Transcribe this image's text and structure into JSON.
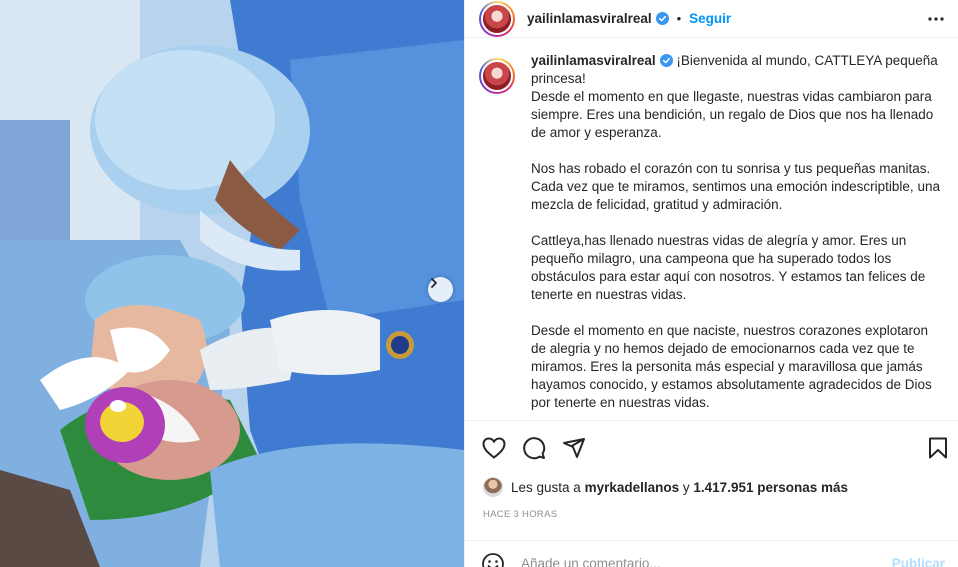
{
  "post": {
    "username": "yailinlamasviralreal",
    "follow_label": "Seguir",
    "separator": "•",
    "caption_paragraphs": [
      "¡Bienvenida al mundo, CATTLEYA pequeña princesa!\nDesde el momento en que llegaste, nuestras vidas cambiaron para siempre. Eres una bendición, un regalo de Dios que nos ha llenado de amor y esperanza.",
      "Nos has robado el corazón con tu sonrisa y tus pequeñas manitas. Cada vez que te miramos, sentimos una emoción indescriptible, una mezcla de felicidad, gratitud y admiración.",
      "Cattleya,has llenado nuestras vidas de alegría y amor. Eres un pequeño milagro, una campeona que ha superado todos los obstáculos para estar aquí con nosotros. Y estamos tan felices de tenerte en nuestras vidas.",
      "Desde el momento en que naciste, nuestros corazones explotaron de alegria y no hemos dejado de emocionarnos cada vez que te miramos. Eres la personita más especial y maravillosa que jamás hayamos conocido, y estamos absolutamente agradecidos de Dios por tenerte en nuestras vidas."
    ],
    "likes": {
      "prefix": "Les gusta a",
      "user": "myrkadellanos",
      "connector": "y",
      "count": "1.417.951 personas más"
    },
    "timestamp": "HACE 3 HORAS",
    "comment": {
      "placeholder": "Añade un comentario...",
      "publish_label": "Publicar"
    }
  },
  "colors": {
    "accent": "#0095f6",
    "publish_disabled": "#b2dffc",
    "text": "#262626",
    "muted": "#8e8e8e",
    "verified": "#3897f0"
  },
  "icons": [
    "verified-badge-icon",
    "more-options-icon",
    "heart-icon",
    "comment-icon",
    "share-icon",
    "bookmark-icon",
    "emoji-icon",
    "chevron-right-icon"
  ]
}
